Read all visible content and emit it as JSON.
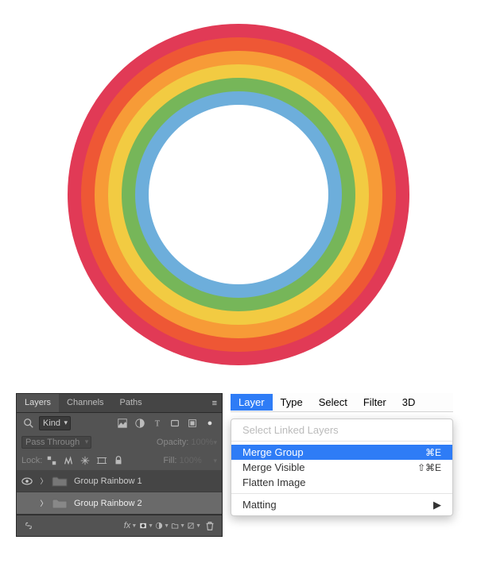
{
  "rainbow": {
    "colors": [
      "#e13a56",
      "#ee5735",
      "#f79b37",
      "#f2cb42",
      "#76b659",
      "#6daedb"
    ]
  },
  "layers_panel": {
    "tabs": {
      "layers": "Layers",
      "channels": "Channels",
      "paths": "Paths"
    },
    "kind_label": "Kind",
    "blend_mode": "Pass Through",
    "opacity_label": "Opacity:",
    "opacity_value": "100%",
    "lock_label": "Lock:",
    "fill_label": "Fill:",
    "fill_value": "100%",
    "layers": [
      {
        "name": "Group Rainbow 1",
        "visible": true,
        "selected": false
      },
      {
        "name": "Group Rainbow 2",
        "visible": false,
        "selected": true
      }
    ],
    "fx_label": "fx"
  },
  "menu": {
    "bar": {
      "layer": "Layer",
      "type": "Type",
      "select": "Select",
      "filter": "Filter",
      "threeD": "3D"
    },
    "items": {
      "select_linked": "Select Linked Layers",
      "merge_group": "Merge Group",
      "merge_group_sc": "⌘E",
      "merge_visible": "Merge Visible",
      "merge_visible_sc": "⇧⌘E",
      "flatten": "Flatten Image",
      "matting": "Matting"
    }
  }
}
